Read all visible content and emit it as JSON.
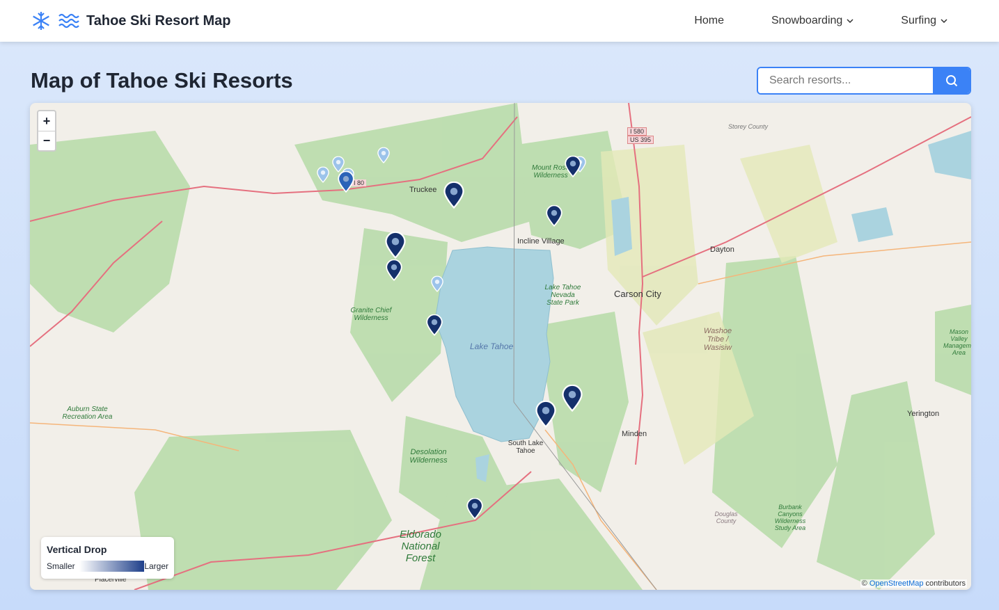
{
  "nav": {
    "title": "Tahoe Ski Resort Map",
    "links": [
      {
        "label": "Home"
      },
      {
        "label": "Snowboarding"
      },
      {
        "label": "Surfing"
      }
    ]
  },
  "header": {
    "title": "Map of Tahoe Ski Resorts"
  },
  "search": {
    "placeholder": "Search resorts..."
  },
  "map": {
    "zoom_in": "+",
    "zoom_out": "−",
    "labels": [
      "Truckee",
      "Incline Village",
      "Carson City",
      "Dayton",
      "Lake Tahoe",
      "South Lake Tahoe",
      "Minden",
      "Yerington",
      "Placerville",
      "Storey County",
      "I 580",
      "US 395",
      "I 80",
      "Mount Rose Wilderness",
      "Lake Tahoe Nevada State Park",
      "Granite Chief Wilderness",
      "Washoe Tribe / Wasisiw",
      "Auburn State Recreation Area",
      "Desolation Wilderness",
      "Eldorado National Forest",
      "Douglas County",
      "Burbank Canyons Wilderness Study Area",
      "Mason Valley Management Area"
    ],
    "attribution_prefix": "© ",
    "attribution_link": "OpenStreetMap",
    "attribution_suffix": " contributors"
  },
  "legend": {
    "title": "Vertical Drop",
    "low": "Smaller",
    "high": "Larger"
  },
  "colors": {
    "accent": "#3b82f6",
    "marker_dark": "#14306b",
    "marker_light": "#9cc3ea",
    "lake": "#aad3df",
    "forest": "#a7d49a"
  }
}
